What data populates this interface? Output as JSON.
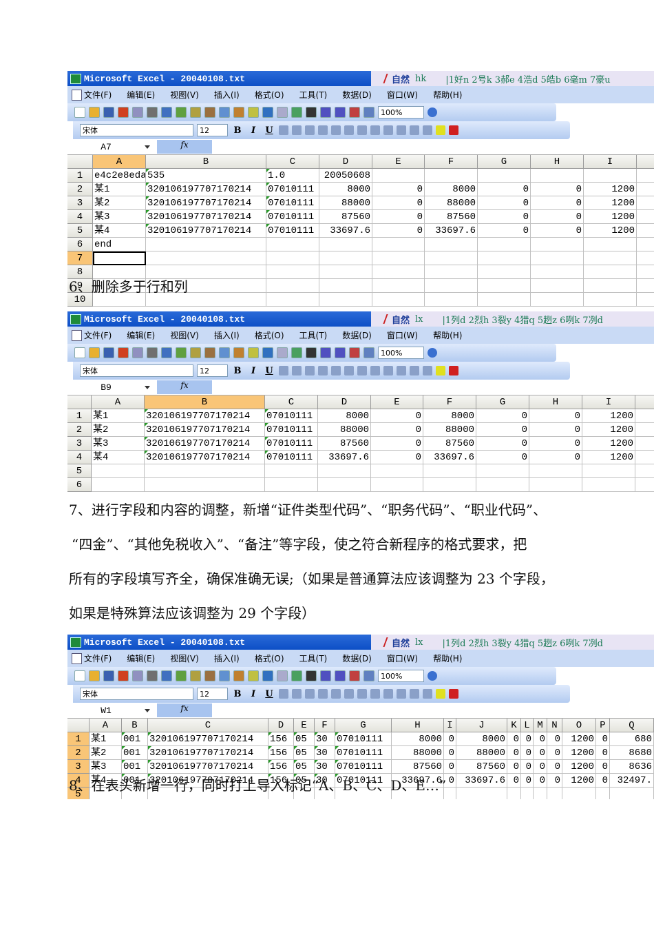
{
  "windows": [
    {
      "title": "Microsoft Excel - 20040108.txt",
      "ime": {
        "mode": "自然",
        "code": "hk",
        "candidates": "|1好n 2号k 3郝e 4浩d 5皓b 6毫m 7豪u"
      },
      "menu": [
        "文件(F)",
        "编辑(E)",
        "视图(V)",
        "插入(I)",
        "格式(O)",
        "工具(T)",
        "数据(D)",
        "窗口(W)",
        "帮助(H)"
      ],
      "zoom": "100%",
      "font": "宋体",
      "font_size": "12",
      "name_box": "A7",
      "fx": "fx",
      "columns": [
        "A",
        "B",
        "C",
        "D",
        "E",
        "F",
        "G",
        "H",
        "I",
        ""
      ],
      "active_col": 0,
      "active_row": 7,
      "rows": [
        [
          "1",
          [
            "e4c2e8eda",
            "535",
            "1.0",
            20050608,
            "",
            "",
            "",
            "",
            ""
          ]
        ],
        [
          "2",
          [
            "某1",
            "320106197707170214",
            "07010111",
            8000,
            0,
            8000,
            0,
            0,
            1200
          ]
        ],
        [
          "3",
          [
            "某2",
            "320106197707170214",
            "07010111",
            88000,
            0,
            88000,
            0,
            0,
            1200
          ]
        ],
        [
          "4",
          [
            "某3",
            "320106197707170214",
            "07010111",
            87560,
            0,
            87560,
            0,
            0,
            1200
          ]
        ],
        [
          "5",
          [
            "某4",
            "320106197707170214",
            "07010111",
            "33697.6",
            0,
            "33697.6",
            0,
            0,
            1200
          ]
        ],
        [
          "6",
          [
            "end",
            "",
            "",
            "",
            "",
            "",
            "",
            "",
            ""
          ]
        ],
        [
          "7",
          [
            "",
            "",
            "",
            "",
            "",
            "",
            "",
            "",
            ""
          ]
        ],
        [
          "8",
          [
            "",
            "",
            "",
            "",
            "",
            "",
            "",
            "",
            ""
          ]
        ],
        [
          "9",
          [
            "",
            "",
            "",
            "",
            "",
            "",
            "",
            "",
            ""
          ]
        ],
        [
          "10",
          [
            "",
            "",
            "",
            "",
            "",
            "",
            "",
            "",
            ""
          ]
        ]
      ]
    },
    {
      "title": "Microsoft Excel - 20040108.txt",
      "ime": {
        "mode": "自然",
        "code": "lx",
        "candidates": "|1列d 2烈h 3裂y 4猎q 5趔z 6咧k 7冽d"
      },
      "menu": [
        "文件(F)",
        "编辑(E)",
        "视图(V)",
        "插入(I)",
        "格式(O)",
        "工具(T)",
        "数据(D)",
        "窗口(W)",
        "帮助(H)"
      ],
      "zoom": "100%",
      "font": "宋体",
      "font_size": "12",
      "name_box": "B9",
      "fx": "fx",
      "columns": [
        "A",
        "B",
        "C",
        "D",
        "E",
        "F",
        "G",
        "H",
        "I",
        ""
      ],
      "active_col": 1,
      "active_row": 0,
      "rows": [
        [
          "1",
          [
            "某1",
            "320106197707170214",
            "07010111",
            8000,
            0,
            8000,
            0,
            0,
            1200
          ]
        ],
        [
          "2",
          [
            "某2",
            "320106197707170214",
            "07010111",
            88000,
            0,
            88000,
            0,
            0,
            1200
          ]
        ],
        [
          "3",
          [
            "某3",
            "320106197707170214",
            "07010111",
            87560,
            0,
            87560,
            0,
            0,
            1200
          ]
        ],
        [
          "4",
          [
            "某4",
            "320106197707170214",
            "07010111",
            "33697.6",
            0,
            "33697.6",
            0,
            0,
            1200
          ]
        ],
        [
          "5",
          [
            "",
            "",
            "",
            "",
            "",
            "",
            "",
            "",
            ""
          ]
        ],
        [
          "6",
          [
            "",
            "",
            "",
            "",
            "",
            "",
            "",
            "",
            ""
          ]
        ]
      ]
    },
    {
      "title": "Microsoft Excel - 20040108.txt",
      "ime": {
        "mode": "自然",
        "code": "lx",
        "candidates": "|1列d 2烈h 3裂y 4猎q 5趔z 6咧k 7冽d"
      },
      "menu": [
        "文件(F)",
        "编辑(E)",
        "视图(V)",
        "插入(I)",
        "格式(O)",
        "工具(T)",
        "数据(D)",
        "窗口(W)",
        "帮助(H)"
      ],
      "zoom": "100%",
      "font": "宋体",
      "font_size": "12",
      "name_box": "W1",
      "fx": "fx",
      "columns": [
        "A",
        "B",
        "C",
        "D",
        "E",
        "F",
        "G",
        "H",
        "I",
        "J",
        "K",
        "L",
        "M",
        "N",
        "O",
        "P",
        "Q"
      ],
      "active_col": -1,
      "active_row": -2,
      "rows": [
        [
          "1",
          [
            "某1",
            "001",
            "320106197707170214",
            "156",
            "05",
            "30",
            "07010111",
            8000,
            0,
            8000,
            0,
            0,
            0,
            0,
            1200,
            0,
            680
          ]
        ],
        [
          "2",
          [
            "某2",
            "001",
            "320106197707170214",
            "156",
            "05",
            "30",
            "07010111",
            88000,
            0,
            88000,
            0,
            0,
            0,
            0,
            1200,
            0,
            8680
          ]
        ],
        [
          "3",
          [
            "某3",
            "001",
            "320106197707170214",
            "156",
            "05",
            "30",
            "07010111",
            87560,
            0,
            87560,
            0,
            0,
            0,
            0,
            1200,
            0,
            8636
          ]
        ],
        [
          "4",
          [
            "某4",
            "001",
            "320106197707170214",
            "156",
            "05",
            "30",
            "07010111",
            "33697.6",
            0,
            "33697.6",
            0,
            0,
            0,
            0,
            1200,
            0,
            "32497."
          ]
        ],
        [
          "5",
          [
            "",
            "",
            "",
            "",
            "",
            "",
            "",
            "",
            "",
            "",
            "",
            "",
            "",
            "",
            "",
            "",
            ""
          ]
        ]
      ]
    }
  ],
  "steps": {
    "step6": "6、删除多于行和列",
    "step7_lines": [
      "7、进行字段和内容的调整，新增“证件类型代码”、“职务代码”、“职业代码”、",
      "“四金”、“其他免税收入”、“备注”等字段，使之符合新程序的格式要求，把",
      "所有的字段填写齐全，确保准确无误;（如果是普通算法应该调整为 23 个字段，",
      "如果是特殊算法应该调整为 29 个字段）"
    ],
    "step8": "8、在表头新增一行，同时打上导入标记“A、B、C、D、E…”"
  }
}
